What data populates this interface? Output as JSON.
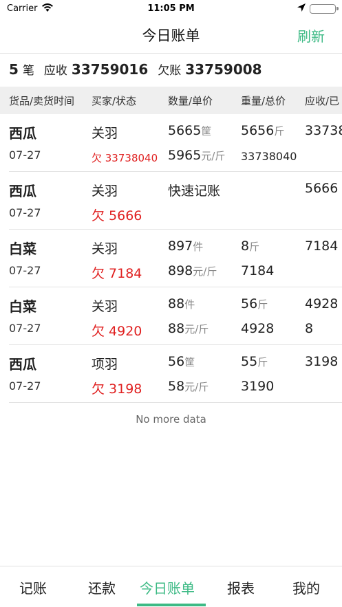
{
  "status_bar": {
    "carrier": "Carrier",
    "time": "11:05 PM"
  },
  "nav": {
    "title": "今日账单",
    "refresh": "刷新"
  },
  "summary": {
    "count": "5",
    "count_unit": "笔",
    "receivable_label": "应收",
    "receivable": "33759016",
    "owed_label": "欠账",
    "owed": "33759008"
  },
  "table": {
    "headers": [
      "货品/卖货时间",
      "买家/状态",
      "数量/单价",
      "重量/总价",
      "应收/已"
    ],
    "rows": [
      {
        "name": "西瓜",
        "date": "07-27",
        "buyer": "关羽",
        "owe": "欠 33738040",
        "qty": "5665",
        "qty_unit": "筐",
        "price": "5965",
        "price_unit": "元/斤",
        "weight": "5656",
        "weight_unit": "斤",
        "total": "33738040",
        "recv": "33738",
        "recv2": ""
      },
      {
        "name": "西瓜",
        "date": "07-27",
        "buyer": "关羽",
        "owe": "欠 5666",
        "qty": "快速记账",
        "qty_unit": "",
        "price": "",
        "price_unit": "",
        "weight": "",
        "weight_unit": "",
        "total": "",
        "recv": "5666",
        "recv2": ""
      },
      {
        "name": "白菜",
        "date": "07-27",
        "buyer": "关羽",
        "owe": "欠 7184",
        "qty": "897",
        "qty_unit": "件",
        "price": "898",
        "price_unit": "元/斤",
        "weight": "8",
        "weight_unit": "斤",
        "total": "7184",
        "recv": "7184",
        "recv2": ""
      },
      {
        "name": "白菜",
        "date": "07-27",
        "buyer": "关羽",
        "owe": "欠 4920",
        "qty": "88",
        "qty_unit": "件",
        "price": "88",
        "price_unit": "元/斤",
        "weight": "56",
        "weight_unit": "斤",
        "total": "4928",
        "recv": "4928",
        "recv2": "8"
      },
      {
        "name": "西瓜",
        "date": "07-27",
        "buyer": "项羽",
        "owe": "欠 3198",
        "qty": "56",
        "qty_unit": "筐",
        "price": "58",
        "price_unit": "元/斤",
        "weight": "55",
        "weight_unit": "斤",
        "total": "3190",
        "recv": "3198",
        "recv2": ""
      }
    ]
  },
  "list_footer": "No more data",
  "tabs": [
    {
      "label": "记账"
    },
    {
      "label": "还款"
    },
    {
      "label": "今日账单"
    },
    {
      "label": "报表"
    },
    {
      "label": "我的"
    }
  ],
  "colors": {
    "accent": "#3dba85",
    "owe_red": "#e02020"
  }
}
